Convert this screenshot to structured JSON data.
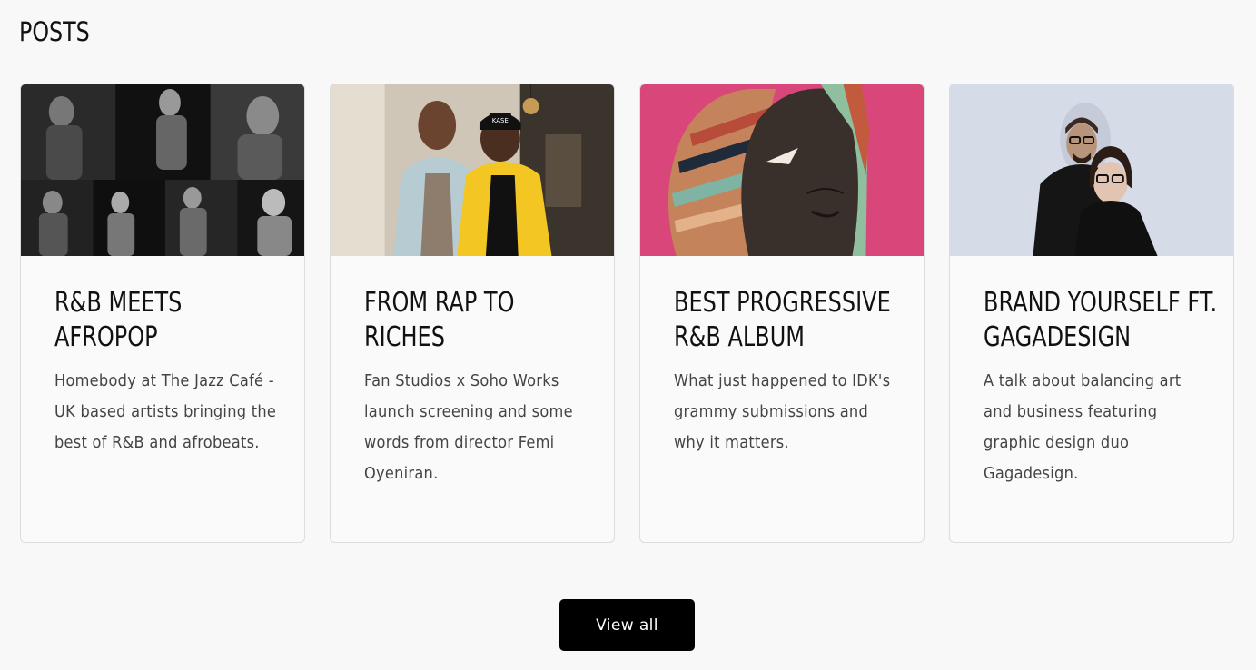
{
  "section": {
    "title": "POSTS"
  },
  "posts": [
    {
      "title": "R&B MEETS AFROPOP",
      "excerpt": "Homebody at The Jazz Café - UK based artists bringing the best of R&B and afrobeats.",
      "image": "performers-collage-photo"
    },
    {
      "title": "FROM RAP TO RICHES",
      "excerpt": "Fan Studios x Soho Works launch screening and some words from director Femi Oyeniran.",
      "image": "two-men-portrait-photo",
      "cap_text": "KASE"
    },
    {
      "title": "BEST PROGRESSIVE R&B ALBUM",
      "excerpt": "What just happened to IDK's grammy submissions and why it matters.",
      "image": "abstract-mask-painting"
    },
    {
      "title": "BRAND YOURSELF FT. GAGADESIGN",
      "excerpt": "A talk about balancing art and business featuring graphic design duo Gagadesign.",
      "image": "design-duo-portrait-photo"
    }
  ],
  "actions": {
    "view_all_label": "View all"
  },
  "colors": {
    "background": "#f8f8f8",
    "card_border": "#dcdcdc",
    "button_bg": "#000000",
    "button_text": "#ffffff",
    "painting_pink": "#d9477a"
  }
}
